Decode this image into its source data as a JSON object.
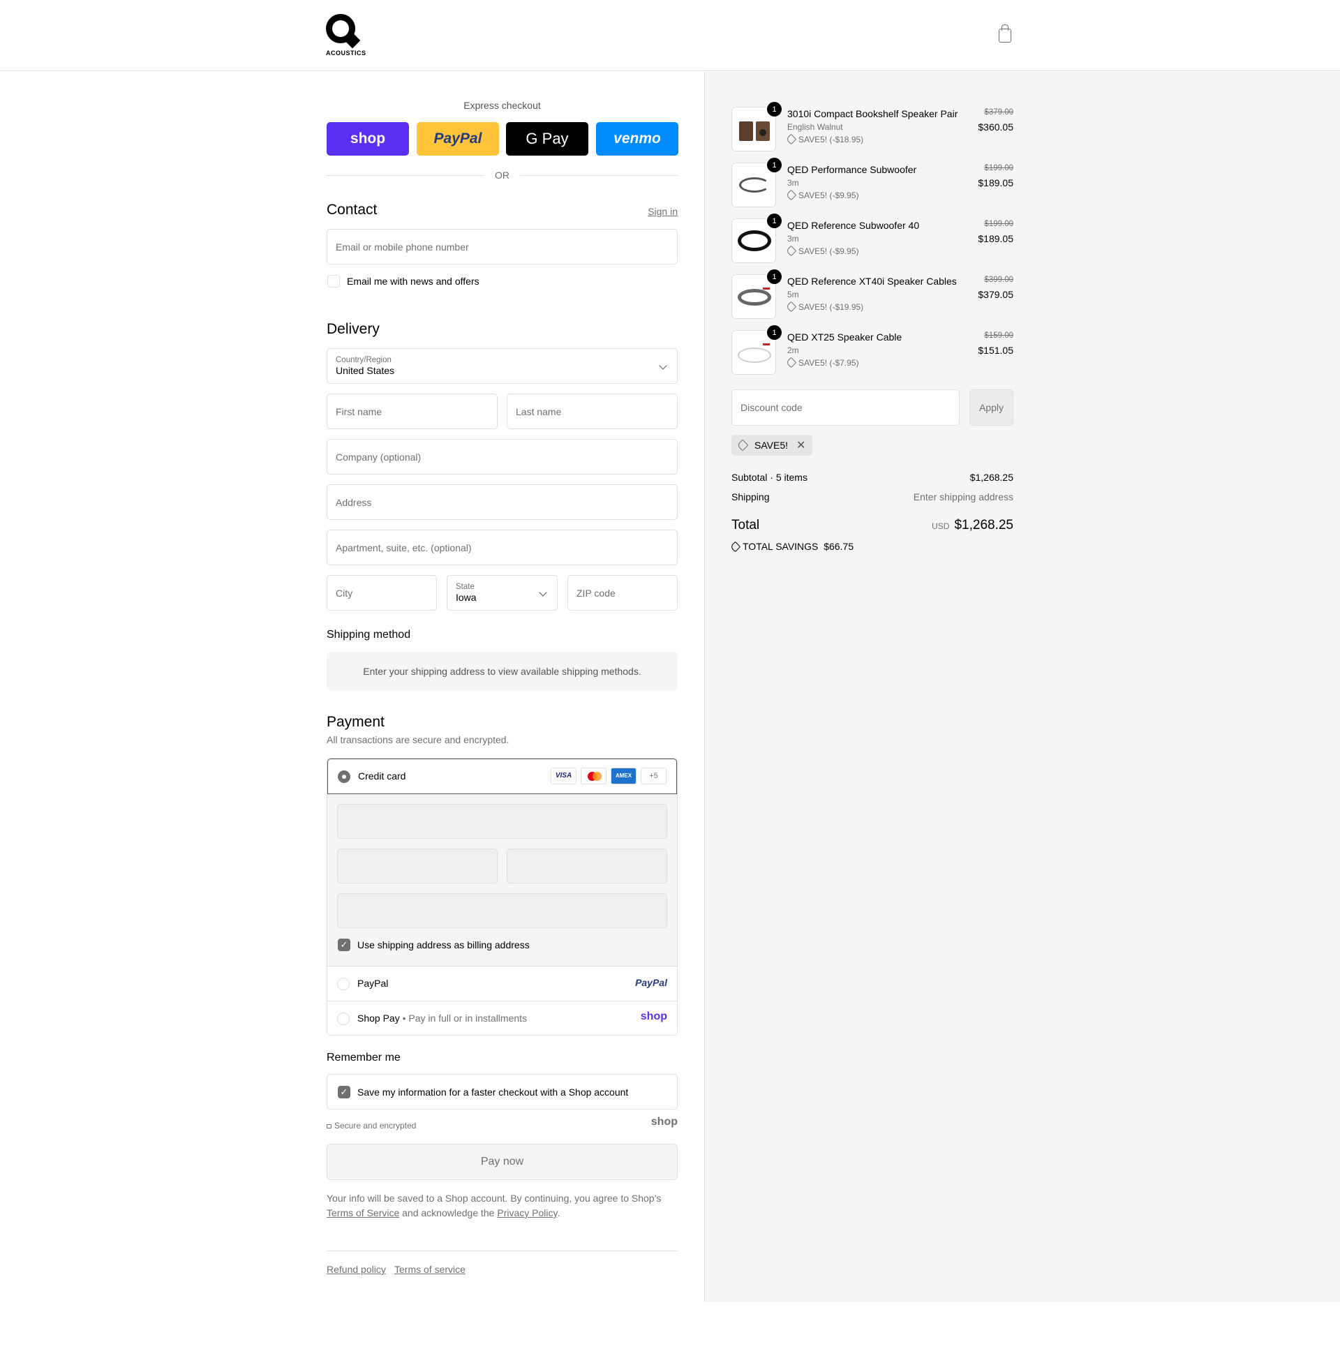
{
  "brand": {
    "logo_text": "ACOUSTICS",
    "logo_letter": "Q"
  },
  "colors": {
    "shop": "#5a31f4",
    "paypal": "#ffc439",
    "gpay": "#000000",
    "venmo": "#008cff",
    "bg_sidebar": "#f5f5f5"
  },
  "express": {
    "title": "Express checkout",
    "buttons": [
      {
        "label": "shop"
      },
      {
        "label": "PayPal"
      },
      {
        "label": "G Pay"
      },
      {
        "label": "venmo"
      }
    ],
    "or": "OR"
  },
  "contact": {
    "title": "Contact",
    "sign_in": "Sign in",
    "email_placeholder": "Email or mobile phone number",
    "newsletter_label": "Email me with news and offers"
  },
  "delivery": {
    "title": "Delivery",
    "country_label": "Country/Region",
    "country_value": "United States",
    "first_name": "First name",
    "last_name": "Last name",
    "company": "Company (optional)",
    "address": "Address",
    "apartment": "Apartment, suite, etc. (optional)",
    "city": "City",
    "state_label": "State",
    "state_value": "Iowa",
    "zip": "ZIP code"
  },
  "shipping_method": {
    "title": "Shipping method",
    "notice": "Enter your shipping address to view available shipping methods."
  },
  "payment": {
    "title": "Payment",
    "subtitle": "All transactions are secure and encrypted.",
    "credit_card": "Credit card",
    "card_brands": [
      "VISA",
      "AMEX"
    ],
    "more_cards": "+5",
    "billing_label": "Use shipping address as billing address",
    "paypal": "PayPal",
    "paypal_logo": "PayPal",
    "shop_pay": "Shop Pay",
    "shop_pay_sub": "Pay in full or in installments",
    "shop_logo": "shop"
  },
  "remember": {
    "title": "Remember me",
    "save_label": "Save my information for a faster checkout with a Shop account",
    "secure": "Secure and encrypted",
    "shop_logo": "shop"
  },
  "pay_now": "Pay now",
  "legal": {
    "text1": "Your info will be saved to a Shop account. By continuing, you agree to Shop’s",
    "terms": "Terms of Service",
    "text2": "and acknowledge the",
    "privacy": "Privacy Policy",
    "period": "."
  },
  "footer": {
    "refund": "Refund policy",
    "terms": "Terms of service"
  },
  "cart": {
    "items": [
      {
        "qty": "1",
        "name": "3010i Compact Bookshelf Speaker Pair",
        "variant": "English Walnut",
        "discount": "SAVE5! (-$18.95)",
        "old_price": "$379.00",
        "price": "$360.05",
        "icon": "speaker-icon"
      },
      {
        "qty": "1",
        "name": "QED Performance Subwoofer",
        "variant": "3m",
        "discount": "SAVE5! (-$9.95)",
        "old_price": "$199.00",
        "price": "$189.05",
        "icon": "cable-icon"
      },
      {
        "qty": "1",
        "name": "QED Reference Subwoofer 40",
        "variant": "3m",
        "discount": "SAVE5! (-$9.95)",
        "old_price": "$199.00",
        "price": "$189.05",
        "icon": "cable-icon"
      },
      {
        "qty": "1",
        "name": "QED Reference XT40i Speaker Cables",
        "variant": "5m",
        "discount": "SAVE5! (-$19.95)",
        "old_price": "$399.00",
        "price": "$379.05",
        "icon": "cable-icon"
      },
      {
        "qty": "1",
        "name": "QED XT25 Speaker Cable",
        "variant": "2m",
        "discount": "SAVE5! (-$7.95)",
        "old_price": "$159.00",
        "price": "$151.05",
        "icon": "cable-icon"
      }
    ],
    "discount_placeholder": "Discount code",
    "apply": "Apply",
    "applied_code": "SAVE5!",
    "subtotal_label": "Subtotal · 5 items",
    "subtotal_value": "$1,268.25",
    "shipping_label": "Shipping",
    "shipping_value": "Enter shipping address",
    "total_label": "Total",
    "currency": "USD",
    "total_value": "$1,268.25",
    "savings_label": "TOTAL SAVINGS",
    "savings_value": "$66.75"
  }
}
